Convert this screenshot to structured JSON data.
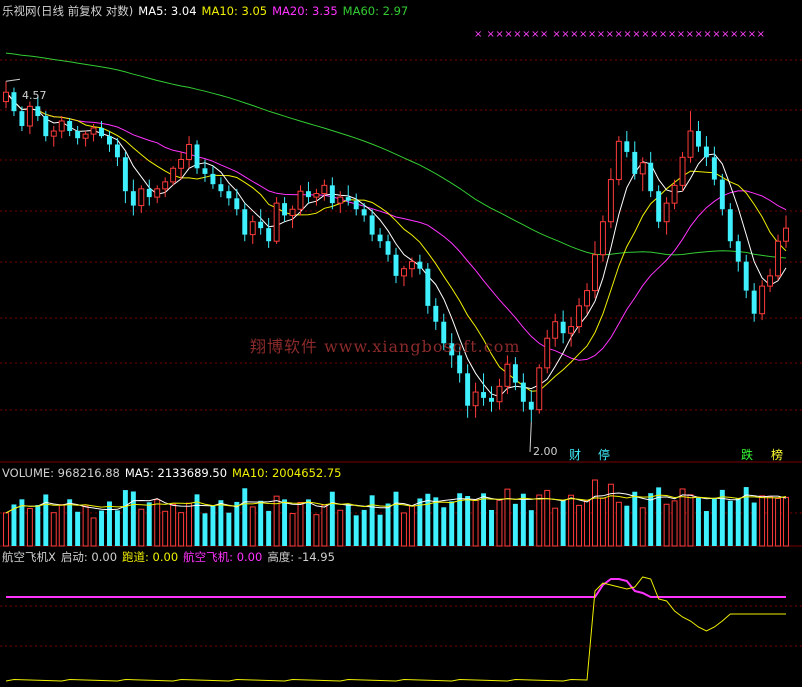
{
  "colors": {
    "bg": "#000000",
    "grid": "#7a0000",
    "up": "#ff3b3b",
    "down": "#3ff0ff",
    "ma5": "#ffffff",
    "ma10": "#f0f000",
    "ma20": "#ff33ff",
    "ma60": "#33cc33",
    "flag": "#ff44ff",
    "text": "#d0d0d0"
  },
  "header": {
    "title": "乐视网(日线 前复权 对数)",
    "ma5_label": "MA5: 3.04",
    "ma10_label": "MA10: 3.05",
    "ma20_label": "MA20: 3.35",
    "ma60_label": "MA60: 2.97"
  },
  "flags_text": "×  ×××××××  ××××××××××××××××××××××××",
  "price_annotations": {
    "high": "4.57",
    "low": "2.00"
  },
  "event_tags": [
    {
      "text": "财",
      "color": "#3ff0ff"
    },
    {
      "text": "停",
      "color": "#3ff0ff"
    },
    {
      "text": "跌",
      "color": "#33ff33"
    },
    {
      "text": "榜",
      "color": "#ffff33"
    }
  ],
  "watermark": "翔博软件 www.xiangbosoft.com",
  "volume_header": {
    "volume_label": "VOLUME: 968216.88",
    "ma5_label": "MA5: 2133689.50",
    "ma10_label": "MA10: 2004652.75"
  },
  "indicator_header": {
    "name": "航空飞机X",
    "start_label": "启动: 0.00",
    "runway_label": "跑道: 0.00",
    "plane_label": "航空飞机: 0.00",
    "height_label": "高度: -14.95"
  },
  "chart_data": [
    {
      "type": "candlestick",
      "title": "乐视网(日线 前复权 对数)",
      "log_scale": true,
      "ylim": [
        1.85,
        5.2
      ],
      "series_moving_averages": {
        "MA5": 3.04,
        "MA10": 3.05,
        "MA20": 3.35,
        "MA60": 2.97
      },
      "ohlc": [
        [
          4.35,
          4.57,
          4.28,
          4.45
        ],
        [
          4.45,
          4.5,
          4.2,
          4.25
        ],
        [
          4.25,
          4.3,
          4.05,
          4.1
        ],
        [
          4.1,
          4.35,
          4.02,
          4.3
        ],
        [
          4.3,
          4.4,
          4.15,
          4.2
        ],
        [
          4.2,
          4.25,
          3.95,
          4.0
        ],
        [
          4.0,
          4.1,
          3.9,
          4.05
        ],
        [
          4.05,
          4.2,
          3.98,
          4.15
        ],
        [
          4.15,
          4.18,
          4.0,
          4.05
        ],
        [
          4.05,
          4.1,
          3.92,
          3.98
        ],
        [
          3.98,
          4.05,
          3.9,
          4.02
        ],
        [
          4.02,
          4.12,
          3.95,
          4.08
        ],
        [
          4.08,
          4.15,
          3.98,
          4.0
        ],
        [
          4.0,
          4.05,
          3.85,
          3.92
        ],
        [
          3.92,
          3.98,
          3.72,
          3.8
        ],
        [
          3.8,
          3.85,
          3.4,
          3.5
        ],
        [
          3.5,
          3.6,
          3.3,
          3.38
        ],
        [
          3.38,
          3.55,
          3.32,
          3.52
        ],
        [
          3.52,
          3.6,
          3.38,
          3.45
        ],
        [
          3.45,
          3.55,
          3.4,
          3.52
        ],
        [
          3.52,
          3.62,
          3.45,
          3.58
        ],
        [
          3.58,
          3.72,
          3.55,
          3.7
        ],
        [
          3.7,
          3.85,
          3.6,
          3.78
        ],
        [
          3.78,
          4.0,
          3.7,
          3.92
        ],
        [
          3.92,
          3.96,
          3.65,
          3.7
        ],
        [
          3.7,
          3.78,
          3.58,
          3.65
        ],
        [
          3.65,
          3.72,
          3.52,
          3.56
        ],
        [
          3.56,
          3.62,
          3.45,
          3.5
        ],
        [
          3.5,
          3.55,
          3.38,
          3.44
        ],
        [
          3.44,
          3.52,
          3.3,
          3.35
        ],
        [
          3.35,
          3.4,
          3.1,
          3.15
        ],
        [
          3.15,
          3.3,
          3.08,
          3.25
        ],
        [
          3.25,
          3.35,
          3.15,
          3.2
        ],
        [
          3.2,
          3.28,
          3.05,
          3.1
        ],
        [
          3.1,
          3.45,
          3.08,
          3.4
        ],
        [
          3.4,
          3.45,
          3.25,
          3.3
        ],
        [
          3.3,
          3.38,
          3.2,
          3.35
        ],
        [
          3.35,
          3.55,
          3.3,
          3.5
        ],
        [
          3.5,
          3.58,
          3.4,
          3.45
        ],
        [
          3.45,
          3.52,
          3.38,
          3.48
        ],
        [
          3.48,
          3.6,
          3.42,
          3.55
        ],
        [
          3.55,
          3.62,
          3.35,
          3.4
        ],
        [
          3.4,
          3.5,
          3.32,
          3.45
        ],
        [
          3.45,
          3.55,
          3.38,
          3.42
        ],
        [
          3.42,
          3.48,
          3.3,
          3.35
        ],
        [
          3.35,
          3.4,
          3.25,
          3.3
        ],
        [
          3.3,
          3.35,
          3.1,
          3.15
        ],
        [
          3.15,
          3.2,
          3.05,
          3.1
        ],
        [
          3.1,
          3.15,
          2.95,
          3.0
        ],
        [
          3.0,
          3.05,
          2.8,
          2.85
        ],
        [
          2.85,
          2.92,
          2.78,
          2.9
        ],
        [
          2.9,
          2.98,
          2.84,
          2.95
        ],
        [
          2.95,
          3.0,
          2.86,
          2.9
        ],
        [
          2.9,
          2.94,
          2.6,
          2.65
        ],
        [
          2.65,
          2.7,
          2.5,
          2.55
        ],
        [
          2.55,
          2.6,
          2.38,
          2.42
        ],
        [
          2.42,
          2.48,
          2.28,
          2.35
        ],
        [
          2.35,
          2.4,
          2.2,
          2.25
        ],
        [
          2.25,
          2.3,
          2.02,
          2.08
        ],
        [
          2.08,
          2.2,
          2.02,
          2.15
        ],
        [
          2.15,
          2.25,
          2.08,
          2.12
        ],
        [
          2.12,
          2.18,
          2.05,
          2.1
        ],
        [
          2.1,
          2.22,
          2.06,
          2.18
        ],
        [
          2.18,
          2.35,
          2.14,
          2.3
        ],
        [
          2.3,
          2.34,
          2.16,
          2.2
        ],
        [
          2.2,
          2.25,
          2.05,
          2.1
        ],
        [
          2.1,
          2.16,
          2.0,
          2.06
        ],
        [
          2.06,
          2.3,
          2.04,
          2.28
        ],
        [
          2.28,
          2.5,
          2.25,
          2.45
        ],
        [
          2.45,
          2.6,
          2.4,
          2.55
        ],
        [
          2.55,
          2.62,
          2.42,
          2.48
        ],
        [
          2.48,
          2.58,
          2.4,
          2.52
        ],
        [
          2.52,
          2.7,
          2.48,
          2.65
        ],
        [
          2.65,
          2.8,
          2.6,
          2.75
        ],
        [
          2.75,
          3.1,
          2.7,
          3.0
        ],
        [
          3.0,
          3.3,
          2.95,
          3.25
        ],
        [
          3.25,
          3.7,
          3.2,
          3.6
        ],
        [
          3.6,
          4.0,
          3.55,
          3.95
        ],
        [
          3.95,
          4.05,
          3.8,
          3.85
        ],
        [
          3.85,
          3.95,
          3.6,
          3.65
        ],
        [
          3.65,
          3.8,
          3.5,
          3.75
        ],
        [
          3.75,
          3.85,
          3.45,
          3.5
        ],
        [
          3.5,
          3.55,
          3.2,
          3.25
        ],
        [
          3.25,
          3.45,
          3.15,
          3.4
        ],
        [
          3.4,
          3.6,
          3.35,
          3.55
        ],
        [
          3.55,
          3.85,
          3.5,
          3.8
        ],
        [
          3.8,
          4.25,
          3.75,
          4.05
        ],
        [
          4.05,
          4.15,
          3.85,
          3.9
        ],
        [
          3.9,
          4.0,
          3.72,
          3.8
        ],
        [
          3.8,
          3.9,
          3.55,
          3.6
        ],
        [
          3.6,
          3.65,
          3.3,
          3.35
        ],
        [
          3.35,
          3.4,
          3.05,
          3.1
        ],
        [
          3.1,
          3.15,
          2.88,
          2.95
        ],
        [
          2.95,
          3.0,
          2.7,
          2.75
        ],
        [
          2.75,
          2.8,
          2.55,
          2.6
        ],
        [
          2.6,
          2.82,
          2.56,
          2.78
        ],
        [
          2.78,
          2.9,
          2.74,
          2.85
        ],
        [
          2.85,
          3.15,
          2.82,
          3.1
        ],
        [
          3.1,
          3.3,
          3.05,
          3.2
        ]
      ],
      "annotations": {
        "high": "4.57",
        "low": "2.00"
      }
    },
    {
      "type": "bar",
      "title": "VOLUME",
      "ylabel": "",
      "summary": {
        "VOLUME": 968216.88,
        "MA5": 2133689.5,
        "MA10": 2004652.75
      }
    },
    {
      "type": "line",
      "title": "航空飞机X",
      "summary": {
        "启动": 0.0,
        "跑道": 0.0,
        "航空飞机": 0.0,
        "高度": -14.95
      }
    }
  ]
}
